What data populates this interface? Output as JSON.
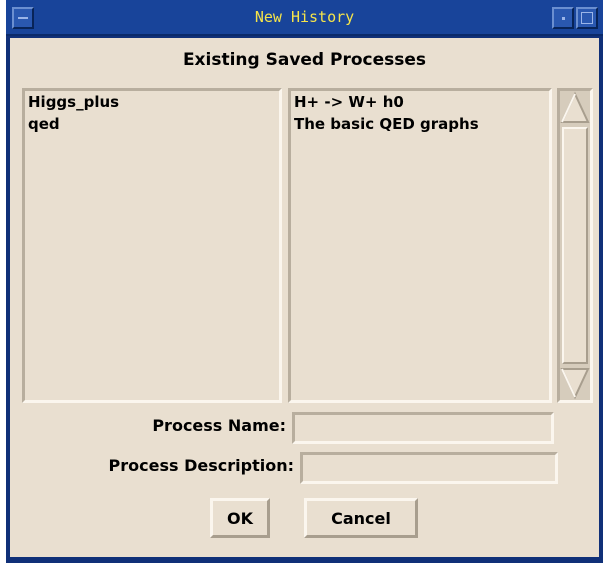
{
  "window": {
    "title": "New History"
  },
  "dialog": {
    "heading": "Existing Saved Processes",
    "processes": [
      {
        "name": "Higgs_plus",
        "description": "H+ -> W+ h0"
      },
      {
        "name": "qed",
        "description": "The basic QED graphs"
      }
    ],
    "process_name_label": "Process Name:",
    "process_name_value": "",
    "process_description_label": "Process Description:",
    "process_description_value": "",
    "ok_label": "OK",
    "cancel_label": "Cancel"
  },
  "icons": {
    "minimize": "minimize-icon",
    "iconify": "iconify-icon",
    "maximize": "maximize-icon",
    "scroll_up": "arrow-up-icon",
    "scroll_down": "arrow-down-icon"
  }
}
